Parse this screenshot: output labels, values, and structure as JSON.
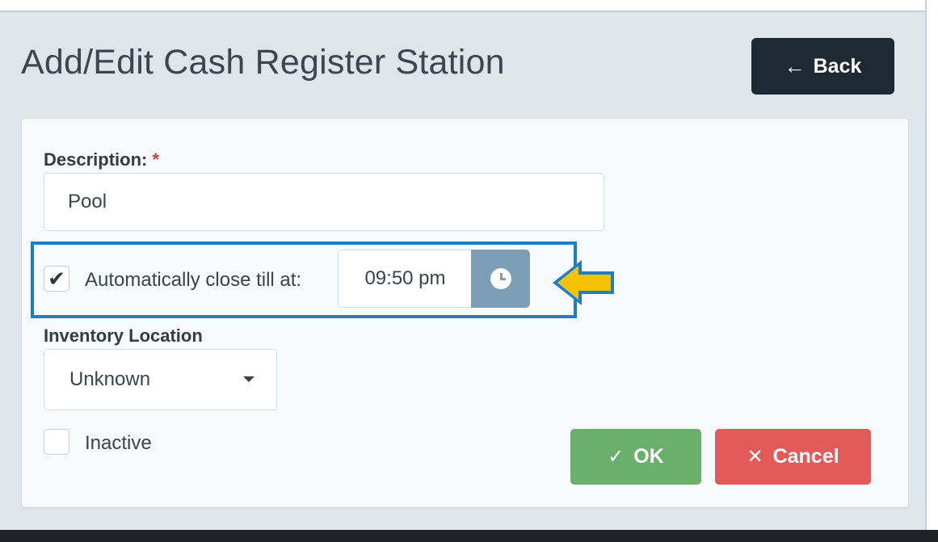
{
  "header": {
    "title": "Add/Edit Cash Register Station",
    "back_label": "Back",
    "back_icon": "←"
  },
  "form": {
    "description": {
      "label": "Description:",
      "required_marker": "*",
      "value": "Pool"
    },
    "auto_close": {
      "checked": true,
      "label": "Automatically close till at:",
      "time_value": "09:50 pm",
      "checkmark": "✔"
    },
    "inventory_location": {
      "label": "Inventory Location",
      "selected": "Unknown"
    },
    "inactive": {
      "checked": false,
      "label": "Inactive"
    }
  },
  "actions": {
    "ok_label": "OK",
    "ok_icon": "✓",
    "cancel_label": "Cancel",
    "cancel_icon": "✕"
  },
  "colors": {
    "back_button": "#1d2a33",
    "ok_button": "#6aaf6b",
    "cancel_button": "#e35a58",
    "highlight": "#1f7ec2",
    "callout_arrow": "#f5c200",
    "clock_button": "#7c9fb7"
  }
}
